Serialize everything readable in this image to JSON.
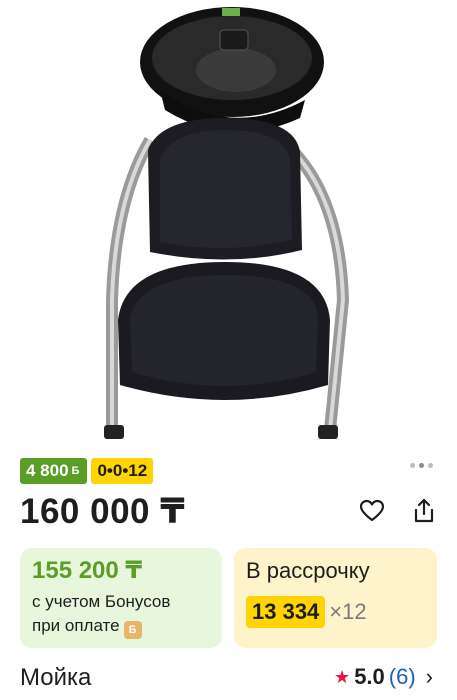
{
  "product": {
    "bonus_badge": "4 800",
    "bonus_badge_sign": "Б",
    "split_badge": "0•0•12",
    "price": "160 000 ₸",
    "name": "Мойка"
  },
  "bonus_card": {
    "amount": "155 200 ₸",
    "note_line1": "с учетом Бонусов",
    "note_line2": "при оплате",
    "coin_glyph": "Б"
  },
  "installment_card": {
    "title": "В рассрочку",
    "monthly": "13 334",
    "multiplier": "×12"
  },
  "rating": {
    "score": "5.0",
    "count": "(6)"
  },
  "colors": {
    "bonus_green": "#5b9e26",
    "installment_yellow": "#ffd400",
    "star_red": "#e3163e",
    "link_blue": "#1f5fbf"
  },
  "icons": [
    "heart-icon",
    "share-icon",
    "star-icon",
    "chevron-right-icon",
    "bonus-coin-icon"
  ],
  "gallery": {
    "dots_count": 3,
    "active_index": 1
  }
}
